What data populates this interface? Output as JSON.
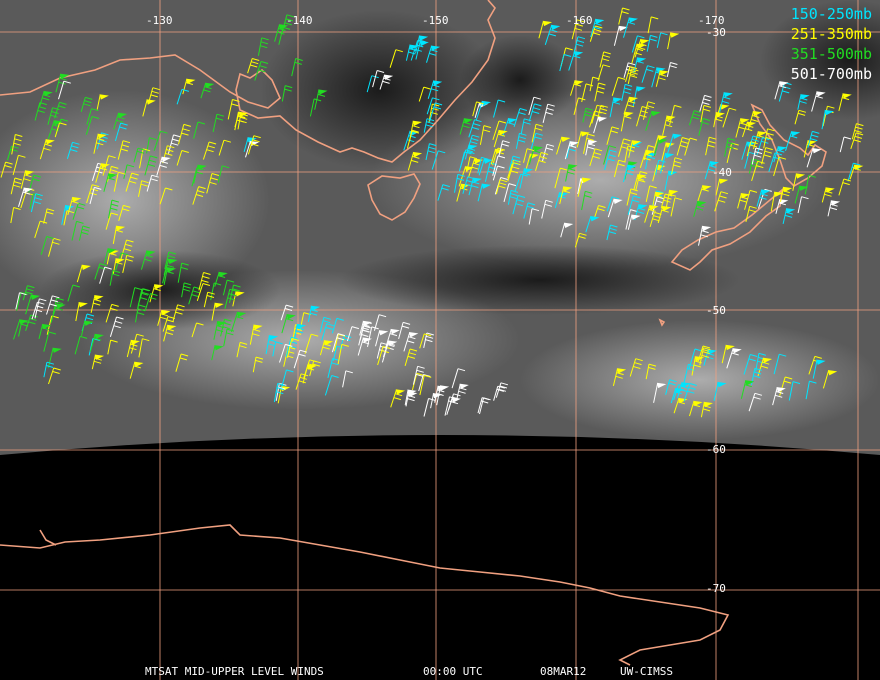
{
  "map": {
    "longitude_labels": [
      "-130",
      "-140",
      "-150",
      "-160",
      "-170"
    ],
    "latitude_labels": [
      "-30",
      "-40",
      "-50",
      "-60",
      "-70"
    ],
    "colors": {
      "grid": "#f0a080",
      "coastline": "#f0a080",
      "disk_edge": "#000000"
    }
  },
  "legend": {
    "items": [
      {
        "label": "150-250mb",
        "color": "#00e5ff"
      },
      {
        "label": "251-350mb",
        "color": "#ffff00"
      },
      {
        "label": "351-500mb",
        "color": "#22dd22"
      },
      {
        "label": "501-700mb",
        "color": "#ffffff"
      }
    ]
  },
  "footer": {
    "product": "MTSAT MID-UPPER LEVEL WINDS",
    "time": "00:00 UTC",
    "date": "08MAR12",
    "source": "UW-CIMSS"
  }
}
